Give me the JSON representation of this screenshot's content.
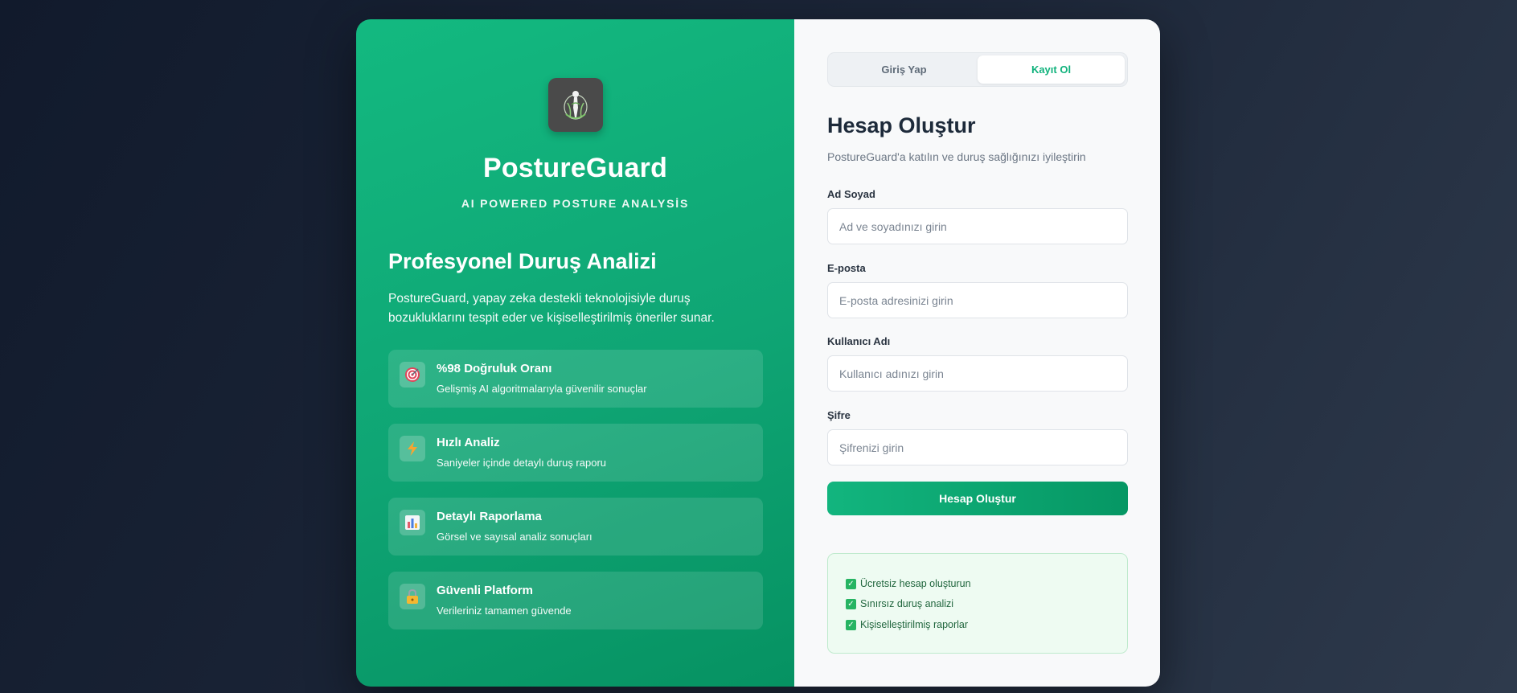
{
  "brand": {
    "name": "PostureGuard",
    "tagline": "AI POWERED POSTURE ANALYSİS"
  },
  "intro": {
    "title": "Profesyonel Duruş Analizi",
    "description": "PostureGuard, yapay zeka destekli teknolojisiyle duruş bozukluklarını tespit eder ve kişiselleştirilmiş öneriler sunar."
  },
  "features": [
    {
      "icon": "target-icon",
      "title": "%98 Doğruluk Oranı",
      "desc": "Gelişmiş AI algoritmalarıyla güvenilir sonuçlar"
    },
    {
      "icon": "lightning-icon",
      "title": "Hızlı Analiz",
      "desc": "Saniyeler içinde detaylı duruş raporu"
    },
    {
      "icon": "bar-chart-icon",
      "title": "Detaylı Raporlama",
      "desc": "Görsel ve sayısal analiz sonuçları"
    },
    {
      "icon": "lock-icon",
      "title": "Güvenli Platform",
      "desc": "Verileriniz tamamen güvende"
    }
  ],
  "tabs": {
    "login": "Giriş Yap",
    "register": "Kayıt Ol",
    "active": "register"
  },
  "form": {
    "title": "Hesap Oluştur",
    "subtitle": "PostureGuard'a katılın ve duruş sağlığınızı iyileştirin",
    "fields": [
      {
        "label": "Ad Soyad",
        "placeholder": "Ad ve soyadınızı girin",
        "value": ""
      },
      {
        "label": "E-posta",
        "placeholder": "E-posta adresinizi girin",
        "value": ""
      },
      {
        "label": "Kullanıcı Adı",
        "placeholder": "Kullanıcı adınızı girin",
        "value": ""
      },
      {
        "label": "Şifre",
        "placeholder": "Şifrenizi girin",
        "value": ""
      }
    ],
    "submit_label": "Hesap Oluştur"
  },
  "benefits": [
    "Ücretsiz hesap oluşturun",
    "Sınırsız duruş analizi",
    "Kişiselleştirilmiş raporlar"
  ],
  "colors": {
    "accent": "#10b27c",
    "panel_gradient_start": "#13b980",
    "panel_gradient_end": "#069262",
    "benefit_bg": "#eefbf2"
  }
}
